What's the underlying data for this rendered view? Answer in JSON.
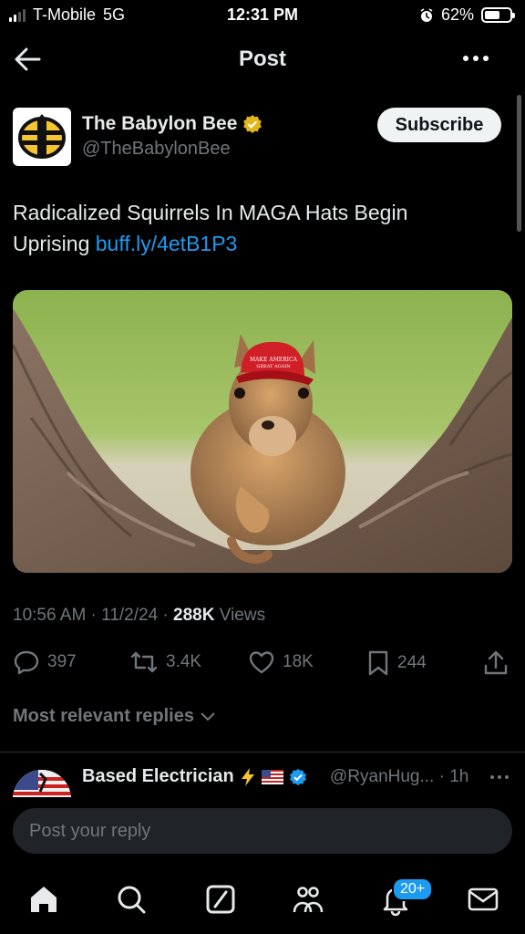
{
  "status_bar": {
    "carrier": "T-Mobile",
    "network": "5G",
    "time": "12:31 PM",
    "battery": "62%",
    "battery_level": 0.62
  },
  "header": {
    "title": "Post"
  },
  "author": {
    "name": "The Babylon Bee",
    "handle": "@TheBabylonBee",
    "subscribe_label": "Subscribe"
  },
  "tweet": {
    "text": "Radicalized Squirrels In MAGA Hats Begin Uprising",
    "link": "buff.ly/4etB1P3",
    "hat_text_1": "MAKE AMERICA",
    "hat_text_2": "GREAT AGAIN"
  },
  "meta": {
    "time": "10:56 AM",
    "date": "11/2/24",
    "views_count": "288K",
    "views_label": "Views"
  },
  "actions": {
    "replies": "397",
    "reposts": "3.4K",
    "likes": "18K",
    "bookmarks": "244"
  },
  "replies_sort": {
    "label": "Most relevant replies"
  },
  "reply_preview": {
    "name": "Based Electrician",
    "handle": "@RyanHug...",
    "time": "· 1h"
  },
  "reply_box": {
    "placeholder": "Post your reply"
  },
  "tabbar": {
    "notifications_badge": "20+"
  },
  "colors": {
    "accent": "#1d9bf0",
    "muted": "#71767b",
    "verified_gold": "#e2b719",
    "hat_red": "#d01f26"
  }
}
